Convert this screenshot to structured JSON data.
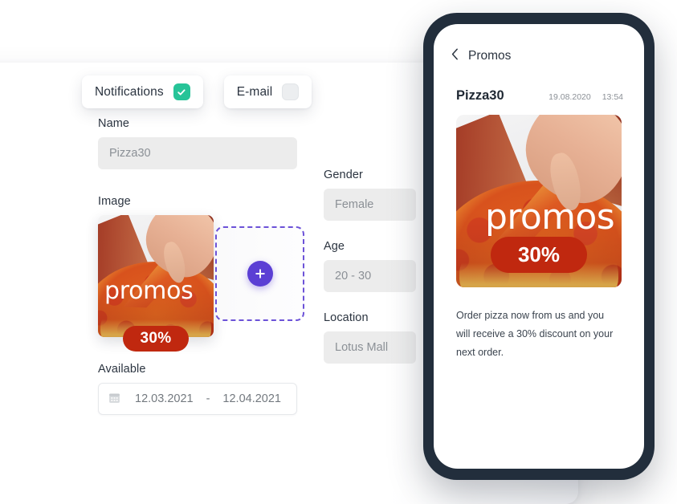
{
  "tabs": [
    {
      "label": "Notifications",
      "state": "checked",
      "icon": "check-badge-icon"
    },
    {
      "label": "E-mail",
      "state": "unchecked",
      "icon": "empty-checkbox-icon"
    }
  ],
  "form": {
    "name": {
      "label": "Name",
      "value": "Pizza30"
    },
    "image": {
      "label": "Image",
      "add_icon": "plus-icon",
      "overlay_text": "promos",
      "discount": "30%"
    },
    "available": {
      "label": "Available",
      "icon": "calendar-icon",
      "start_date": "12.03.2021",
      "separator": "-",
      "end_date": "12.04.2021"
    },
    "gender": {
      "label": "Gender",
      "value": "Female"
    },
    "age": {
      "label": "Age",
      "value": "20 - 30"
    },
    "location": {
      "label": "Location",
      "value": "Lotus Mall"
    }
  },
  "phone": {
    "nav": {
      "back_icon": "chevron-left-icon",
      "title": "Promos"
    },
    "promo": {
      "title": "Pizza30",
      "date": "19.08.2020",
      "time": "13:54",
      "overlay_text": "promos",
      "discount": "30%",
      "body": "Order pizza now from us and you will receive a 30% discount on your next order."
    }
  },
  "colors": {
    "accent_purple": "#5b3fd4",
    "check_green": "#27c498",
    "badge_red": "#c0280f",
    "phone_frame": "#222e3c"
  }
}
